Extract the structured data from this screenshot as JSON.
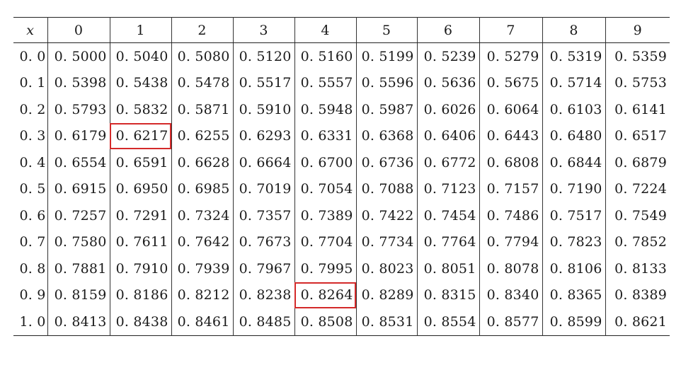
{
  "table": {
    "corner": "x",
    "columns": [
      "0",
      "1",
      "2",
      "3",
      "4",
      "5",
      "6",
      "7",
      "8",
      "9"
    ],
    "rows": [
      {
        "label": "0. 0",
        "values": [
          "0. 5000",
          "0. 5040",
          "0. 5080",
          "0. 5120",
          "0. 5160",
          "0. 5199",
          "0. 5239",
          "0. 5279",
          "0. 5319",
          "0. 5359"
        ]
      },
      {
        "label": "0. 1",
        "values": [
          "0. 5398",
          "0. 5438",
          "0. 5478",
          "0. 5517",
          "0. 5557",
          "0. 5596",
          "0. 5636",
          "0. 5675",
          "0. 5714",
          "0. 5753"
        ]
      },
      {
        "label": "0. 2",
        "values": [
          "0. 5793",
          "0. 5832",
          "0. 5871",
          "0. 5910",
          "0. 5948",
          "0. 5987",
          "0. 6026",
          "0. 6064",
          "0. 6103",
          "0. 6141"
        ]
      },
      {
        "label": "0. 3",
        "values": [
          "0. 6179",
          "0. 6217",
          "0. 6255",
          "0. 6293",
          "0. 6331",
          "0. 6368",
          "0. 6406",
          "0. 6443",
          "0. 6480",
          "0. 6517"
        ]
      },
      {
        "label": "0. 4",
        "values": [
          "0. 6554",
          "0. 6591",
          "0. 6628",
          "0. 6664",
          "0. 6700",
          "0. 6736",
          "0. 6772",
          "0. 6808",
          "0. 6844",
          "0. 6879"
        ]
      },
      {
        "label": "0. 5",
        "values": [
          "0. 6915",
          "0. 6950",
          "0. 6985",
          "0. 7019",
          "0. 7054",
          "0. 7088",
          "0. 7123",
          "0. 7157",
          "0. 7190",
          "0. 7224"
        ]
      },
      {
        "label": "0. 6",
        "values": [
          "0. 7257",
          "0. 7291",
          "0. 7324",
          "0. 7357",
          "0. 7389",
          "0. 7422",
          "0. 7454",
          "0. 7486",
          "0. 7517",
          "0. 7549"
        ]
      },
      {
        "label": "0. 7",
        "values": [
          "0. 7580",
          "0. 7611",
          "0. 7642",
          "0. 7673",
          "0. 7704",
          "0. 7734",
          "0. 7764",
          "0. 7794",
          "0. 7823",
          "0. 7852"
        ]
      },
      {
        "label": "0. 8",
        "values": [
          "0. 7881",
          "0. 7910",
          "0. 7939",
          "0. 7967",
          "0. 7995",
          "0. 8023",
          "0. 8051",
          "0. 8078",
          "0. 8106",
          "0. 8133"
        ]
      },
      {
        "label": "0. 9",
        "values": [
          "0. 8159",
          "0. 8186",
          "0. 8212",
          "0. 8238",
          "0. 8264",
          "0. 8289",
          "0. 8315",
          "0. 8340",
          "0. 8365",
          "0. 8389"
        ]
      },
      {
        "label": "1. 0",
        "values": [
          "0. 8413",
          "0. 8438",
          "0. 8461",
          "0. 8485",
          "0. 8508",
          "0. 8531",
          "0. 8554",
          "0. 8577",
          "0. 8599",
          "0. 8621"
        ]
      }
    ],
    "highlights": [
      {
        "row": 3,
        "col": 1
      },
      {
        "row": 9,
        "col": 4
      }
    ],
    "highlight_color": "#d42a2a"
  }
}
